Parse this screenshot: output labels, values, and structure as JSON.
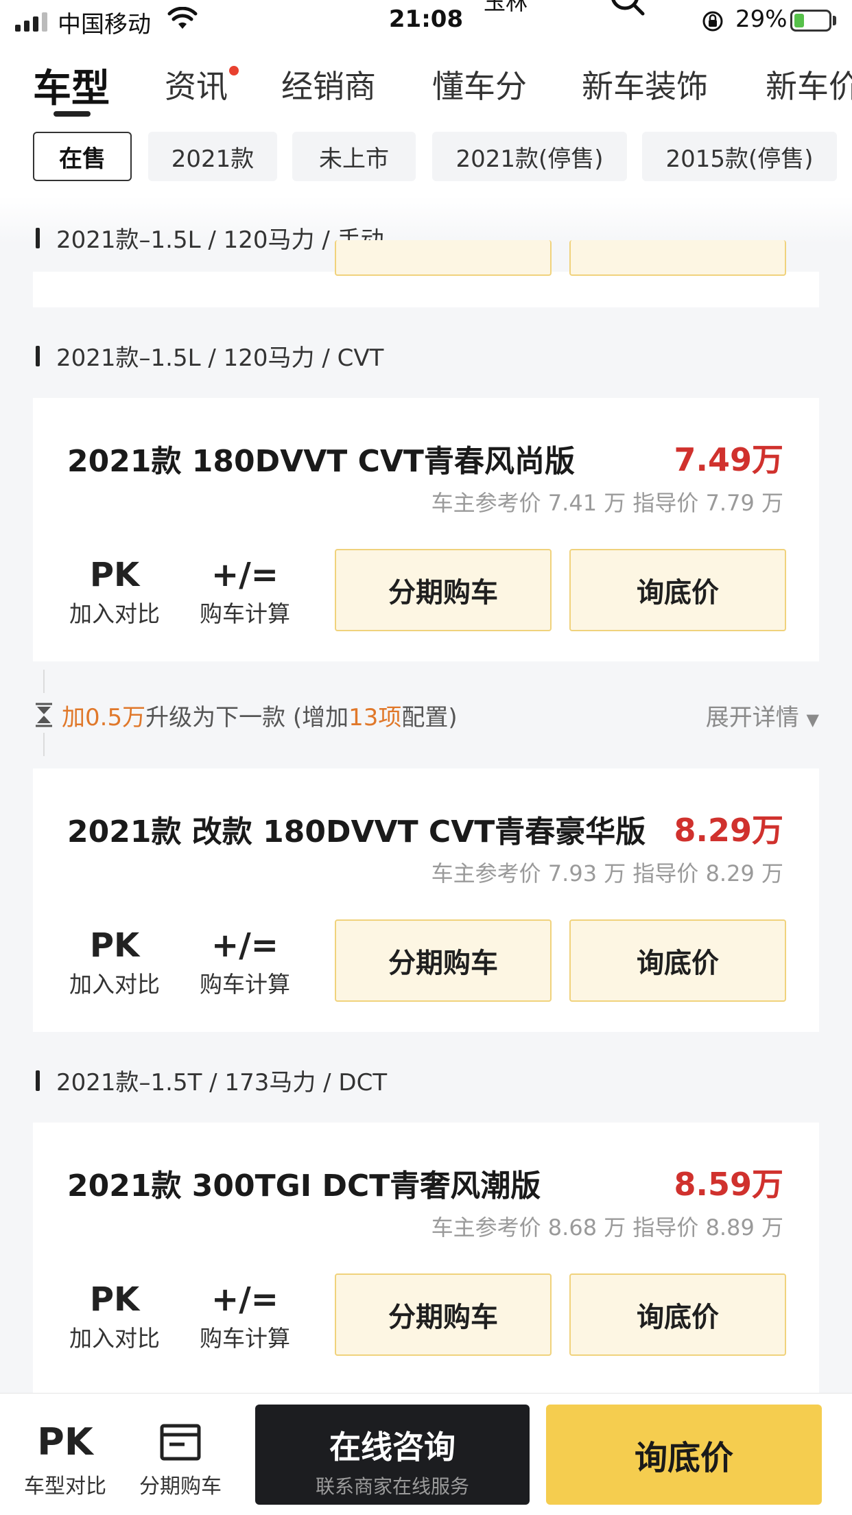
{
  "status_bar": {
    "carrier": "中国移动",
    "time": "21:08",
    "city": "玉林",
    "battery": "29%",
    "battery_level": 0.29
  },
  "tabs": [
    {
      "label": "车型",
      "active": true
    },
    {
      "label": "资讯",
      "dot": true
    },
    {
      "label": "经销商"
    },
    {
      "label": "懂车分"
    },
    {
      "label": "新车装饰"
    },
    {
      "label": "新车价"
    }
  ],
  "filters": [
    {
      "label": "在售",
      "active": true
    },
    {
      "label": "2021款"
    },
    {
      "label": "未上市"
    },
    {
      "label": "2021款(停售)"
    },
    {
      "label": "2015款(停售)"
    }
  ],
  "sections": [
    {
      "header": "2021款–1.5L / 120马力 / 手动"
    },
    {
      "header": "2021款–1.5L / 120马力 / CVT"
    },
    {
      "header": "2021款–1.5T / 173马力 / DCT"
    }
  ],
  "cards": [
    {
      "title": "2021款 180DVVT CVT青春风尚版",
      "price": "7.49万",
      "refs": "车主参考价 7.41 万  指导价 7.79 万"
    },
    {
      "title": "2021款 改款 180DVVT CVT青春豪华版",
      "price": "8.29万",
      "refs": "车主参考价 7.93 万  指导价 8.29 万"
    },
    {
      "title": "2021款 300TGI DCT青奢风潮版",
      "price": "8.59万",
      "refs": "车主参考价 8.68 万  指导价 8.89 万"
    }
  ],
  "card_actions": {
    "pk_icon": "PK",
    "pk_label": "加入对比",
    "calc_icon": "+/=",
    "calc_label": "购车计算",
    "installment": "分期购车",
    "ask_price": "询底价"
  },
  "upgrade": {
    "prefix": "加",
    "amount": "0.5万",
    "mid": "升级为下一款 (增加",
    "count": "13项",
    "suffix": "配置)",
    "expand": "展开详情"
  },
  "bottom_bar": {
    "compare_icon": "PK",
    "compare_label": "车型对比",
    "installment_label": "分期购车",
    "consult_title": "在线咨询",
    "consult_sub": "联系商家在线服务",
    "ask_price": "询底价"
  }
}
